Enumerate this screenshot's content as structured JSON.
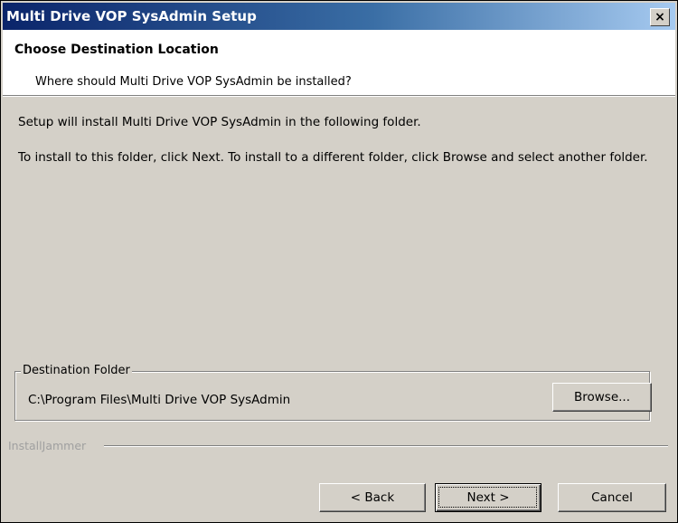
{
  "window": {
    "title": "Multi Drive VOP SysAdmin Setup",
    "close_label": "×"
  },
  "header": {
    "title": "Choose Destination Location",
    "subtitle": "Where should Multi Drive VOP SysAdmin be installed?"
  },
  "body": {
    "line1": "Setup will install Multi Drive VOP SysAdmin in the following folder.",
    "line2": "To install to this folder, click Next.  To install to a different folder, click Browse and select another folder."
  },
  "destination": {
    "group_label": "Destination Folder",
    "path": "C:\\Program Files\\Multi Drive VOP SysAdmin",
    "browse_label": "Browse..."
  },
  "branding": {
    "text": "InstallJammer"
  },
  "buttons": {
    "back_label": "< Back",
    "next_label": "Next >",
    "cancel_label": "Cancel"
  }
}
